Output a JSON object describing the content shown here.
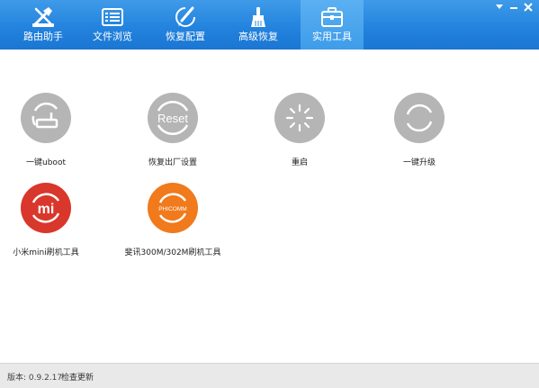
{
  "tabs": [
    {
      "label": "路由助手",
      "icon": "router-tools-icon"
    },
    {
      "label": "文件浏览",
      "icon": "file-browser-icon"
    },
    {
      "label": "恢复配置",
      "icon": "restore-config-icon"
    },
    {
      "label": "高级恢复",
      "icon": "advanced-restore-icon"
    },
    {
      "label": "实用工具",
      "icon": "toolbox-icon",
      "active": true
    }
  ],
  "tools": [
    {
      "label": "一键uboot",
      "icon": "router-refresh-icon",
      "color": "#b5b5b5"
    },
    {
      "label": "恢复出厂设置",
      "icon": "reset-icon",
      "icon_text": "Reset",
      "color": "#b5b5b5"
    },
    {
      "label": "重启",
      "icon": "restart-spinner-icon",
      "color": "#b5b5b5"
    },
    {
      "label": "一键升级",
      "icon": "upgrade-refresh-icon",
      "color": "#b5b5b5"
    },
    {
      "label": "小米mini刷机工具",
      "icon": "xiaomi-logo-icon",
      "icon_text": "mi",
      "color": "#d9372b"
    },
    {
      "label": "斐讯300M/302M刷机工具",
      "icon": "phicomm-logo-icon",
      "icon_text": "PHICOMM",
      "color": "#f07a1c"
    }
  ],
  "status": {
    "version": "版本: 0.9.2.17",
    "check_update": "检查更新"
  },
  "colors": {
    "toolbar": "#2383de",
    "active_tab": "#4aa3ee",
    "statusbar": "#e9e9e9"
  }
}
